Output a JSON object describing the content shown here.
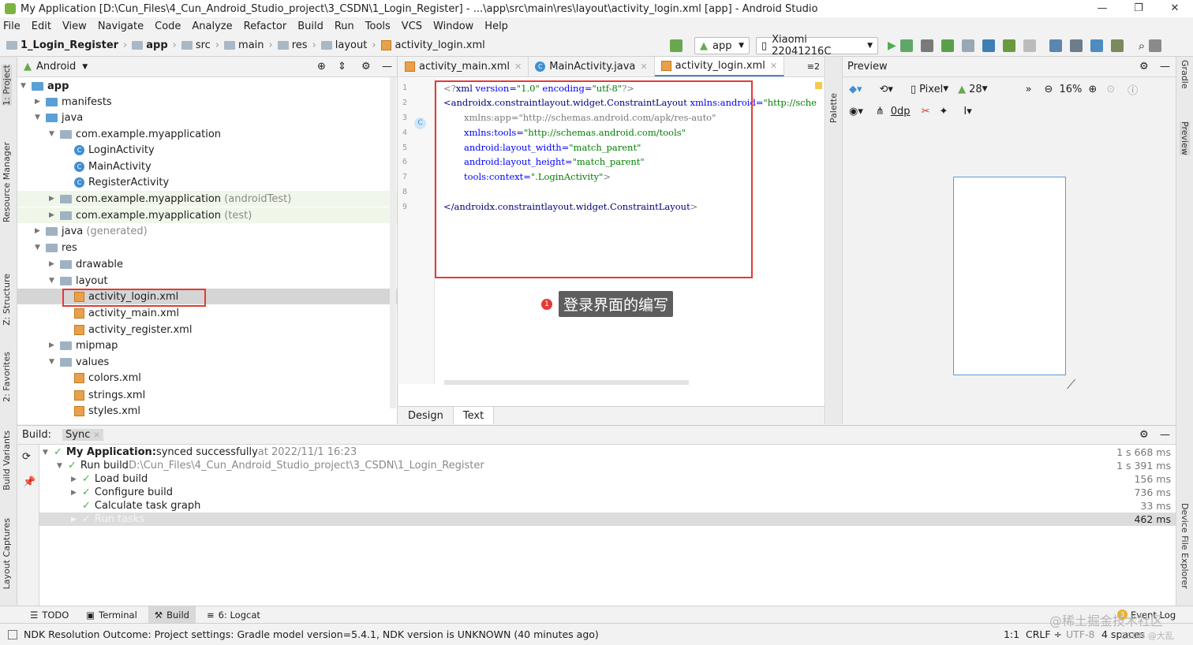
{
  "window": {
    "title": "My Application [D:\\Cun_Files\\4_Cun_Android_Studio_project\\3_CSDN\\1_Login_Register] - ...\\app\\src\\main\\res\\layout\\activity_login.xml [app] - Android Studio",
    "controls": [
      "—",
      "❐",
      "✕"
    ]
  },
  "menu": [
    "File",
    "Edit",
    "View",
    "Navigate",
    "Code",
    "Analyze",
    "Refactor",
    "Build",
    "Run",
    "Tools",
    "VCS",
    "Window",
    "Help"
  ],
  "breadcrumb": [
    "1_Login_Register",
    "app",
    "src",
    "main",
    "res",
    "layout",
    "activity_login.xml"
  ],
  "toolbar": {
    "run_config": "app",
    "device": "Xiaomi 22041216C"
  },
  "left_strip": [
    "1: Project",
    "Resource Manager",
    "Z: Structure",
    "2: Favorites",
    "Build Variants",
    "Layout Captures"
  ],
  "right_strip": [
    "Gradle",
    "Preview",
    "Device File Explorer"
  ],
  "project": {
    "view_mode": "Android",
    "tree": [
      {
        "label": "app",
        "suffix": ""
      },
      {
        "label": "manifests",
        "suffix": ""
      },
      {
        "label": "java",
        "suffix": ""
      },
      {
        "label": "com.example.myapplication",
        "suffix": ""
      },
      {
        "label": "LoginActivity",
        "suffix": ""
      },
      {
        "label": "MainActivity",
        "suffix": ""
      },
      {
        "label": "RegisterActivity",
        "suffix": ""
      },
      {
        "label": "com.example.myapplication",
        "suffix": "(androidTest)"
      },
      {
        "label": "com.example.myapplication",
        "suffix": "(test)"
      },
      {
        "label": "java",
        "suffix": "(generated)"
      },
      {
        "label": "res",
        "suffix": ""
      },
      {
        "label": "drawable",
        "suffix": ""
      },
      {
        "label": "layout",
        "suffix": ""
      },
      {
        "label": "activity_login.xml",
        "suffix": ""
      },
      {
        "label": "activity_main.xml",
        "suffix": ""
      },
      {
        "label": "activity_register.xml",
        "suffix": ""
      },
      {
        "label": "mipmap",
        "suffix": ""
      },
      {
        "label": "values",
        "suffix": ""
      },
      {
        "label": "colors.xml",
        "suffix": ""
      },
      {
        "label": "strings.xml",
        "suffix": ""
      },
      {
        "label": "styles.xml",
        "suffix": ""
      }
    ]
  },
  "editor": {
    "tabs": [
      "activity_main.xml",
      "MainActivity.java",
      "activity_login.xml"
    ],
    "tab_overflow": "≡2",
    "line_numbers": [
      "1",
      "2",
      "3",
      "4",
      "5",
      "6",
      "7",
      "8",
      "9"
    ],
    "code": {
      "l1_open": "<?",
      "l1_tag": "xml",
      "l1_attr1": " version=",
      "l1_val1": "\"1.0\"",
      "l1_attr2": " encoding=",
      "l1_val2": "\"utf-8\"",
      "l1_close": "?>",
      "l2_tag": "<androidx.constraintlayout.widget.ConstraintLayout",
      "l2_attr": " xmlns:android=",
      "l2_val": "\"http://sche",
      "l3_attr": "xmlns:app=",
      "l3_val": "\"http://schemas.android.com/apk/res-auto\"",
      "l4_attr": "xmlns:tools=",
      "l4_val": "\"http://schemas.android.com/tools\"",
      "l5_attr": "android:layout_width=",
      "l5_val": "\"match_parent\"",
      "l6_attr": "android:layout_height=",
      "l6_val": "\"match_parent\"",
      "l7_attr": "tools:context=",
      "l7_val": "\".LoginActivity\"",
      "l7_close": ">",
      "l9_tag": "</androidx.constraintlayout.widget.ConstraintLayout",
      "l9_close": ">"
    },
    "bottom_tabs": [
      "Design",
      "Text"
    ]
  },
  "palette": {
    "label": "Palette"
  },
  "preview": {
    "title": "Preview",
    "device": "Pixel",
    "api": "28",
    "zoom": "16%",
    "margin": "0dp"
  },
  "annotation": {
    "number": "1",
    "label": "登录界面的编写"
  },
  "build": {
    "label": "Build:",
    "tab": "Sync",
    "rows": [
      {
        "bold": "My Application:",
        "text": " synced successfully",
        "meta": " at 2022/11/1 16:23",
        "time": "1 s 668 ms"
      },
      {
        "bold": "",
        "text": "Run build ",
        "meta": "D:\\Cun_Files\\4_Cun_Android_Studio_project\\3_CSDN\\1_Login_Register",
        "time": "1 s 391 ms"
      },
      {
        "bold": "",
        "text": "Load build",
        "meta": "",
        "time": "156 ms"
      },
      {
        "bold": "",
        "text": "Configure build",
        "meta": "",
        "time": "736 ms"
      },
      {
        "bold": "",
        "text": "Calculate task graph",
        "meta": "",
        "time": "33 ms"
      },
      {
        "bold": "",
        "text": "Run tasks",
        "meta": "",
        "time": "462 ms"
      }
    ]
  },
  "tool_tabs": [
    "TODO",
    "Terminal",
    "Build",
    "6: Logcat"
  ],
  "event_log": {
    "count": "3",
    "label": "Event Log"
  },
  "status": {
    "message": "NDK Resolution Outcome: Project settings: Gradle model version=5.4.1, NDK version is UNKNOWN (40 minutes ago)",
    "position": "1:1",
    "line_sep": "CRLF ÷",
    "encoding": "UTF-8",
    "indent": "4 spaces"
  },
  "watermark": {
    "line1": "@稀土掘金技术社区",
    "line2": "CSDN @大乱"
  },
  "colors": {
    "accent": "#4a88c7",
    "annotation_red": "#e53935",
    "success_green": "#4caf50"
  }
}
